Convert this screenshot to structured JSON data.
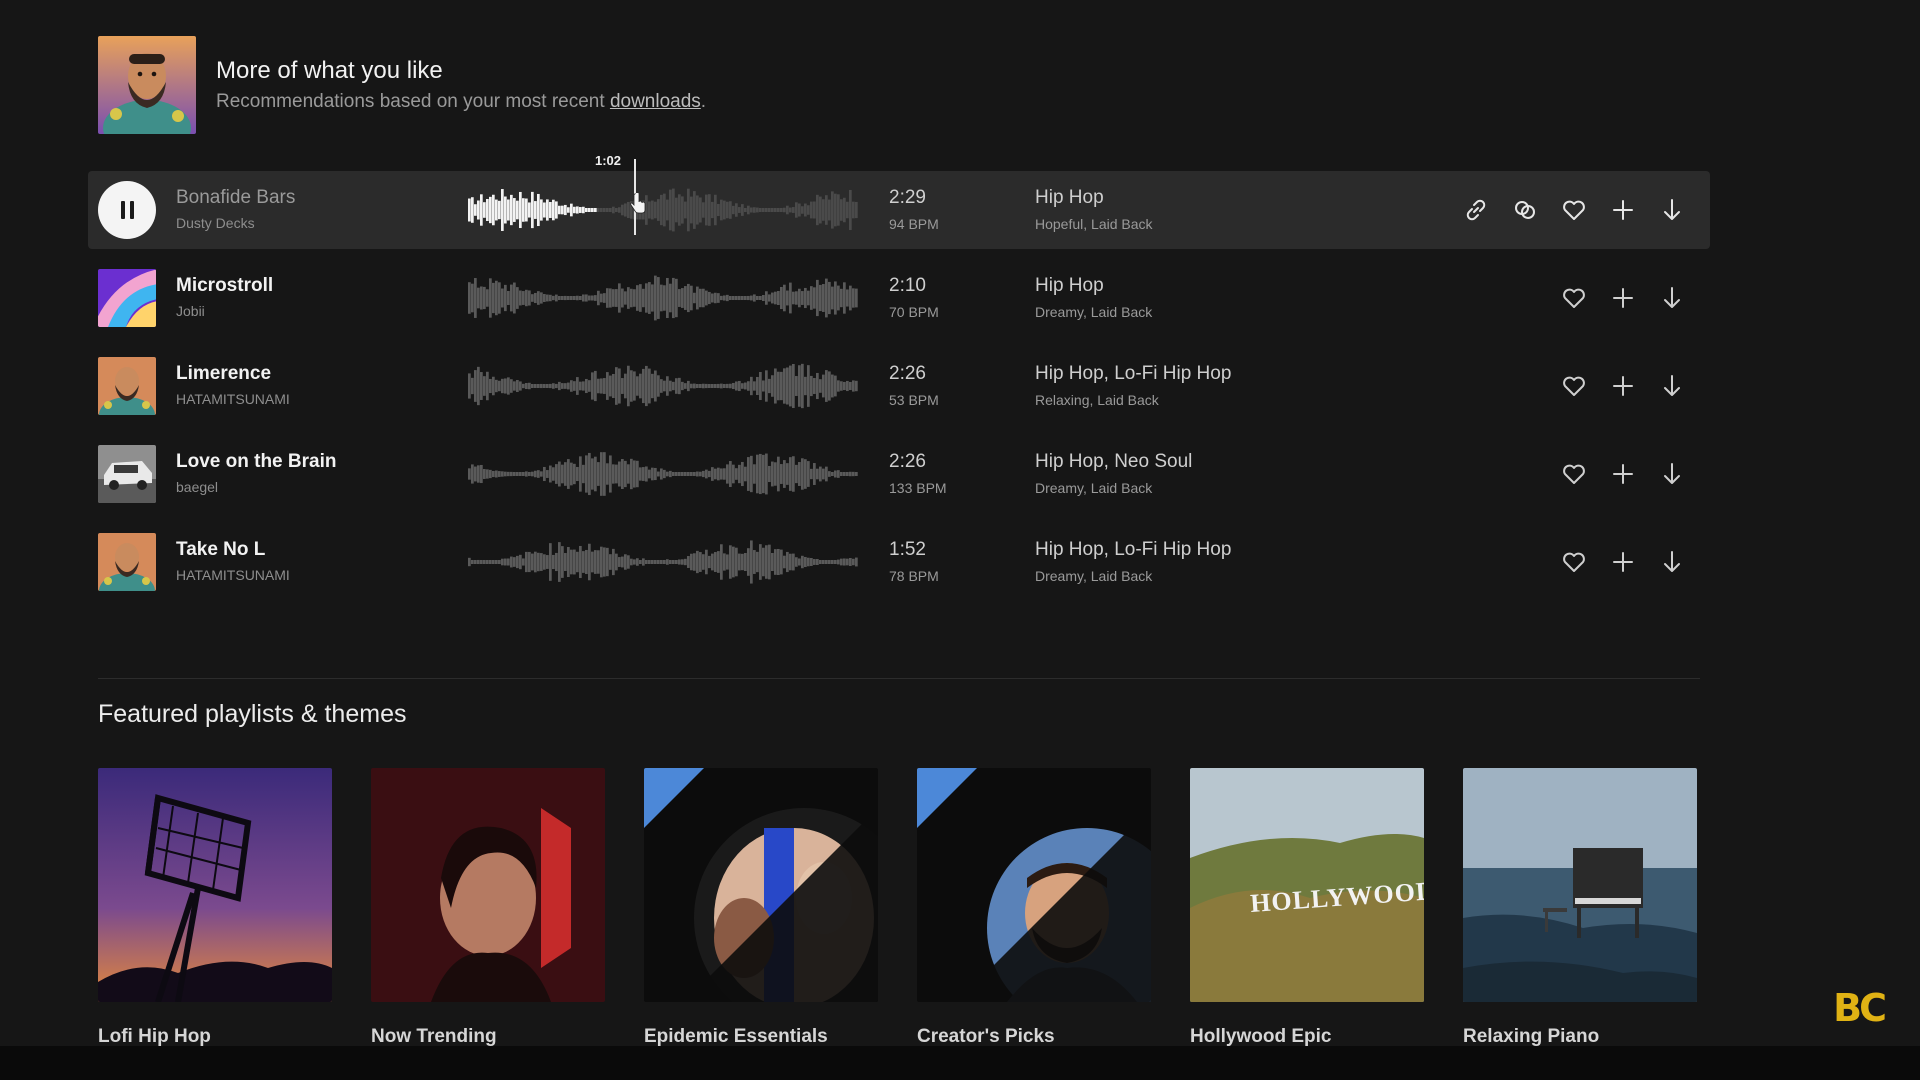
{
  "recommendations": {
    "title": "More of what you like",
    "subtitle_prefix": "Recommendations based on your most recent ",
    "subtitle_link": "downloads",
    "subtitle_suffix": "."
  },
  "player": {
    "current_time": "1:02",
    "progress": 0.42
  },
  "tracks": [
    {
      "title": "Bonafide Bars",
      "artist": "Dusty Decks",
      "duration": "2:29",
      "bpm": "94 BPM",
      "genre": "Hip Hop",
      "moods": "Hopeful, Laid Back",
      "playing": true
    },
    {
      "title": "Microstroll",
      "artist": "Jobii",
      "duration": "2:10",
      "bpm": "70 BPM",
      "genre": "Hip Hop",
      "moods": "Dreamy, Laid Back"
    },
    {
      "title": "Limerence",
      "artist": "HATAMITSUNAMI",
      "duration": "2:26",
      "bpm": "53 BPM",
      "genre": "Hip Hop, Lo-Fi Hip Hop",
      "moods": "Relaxing, Laid Back"
    },
    {
      "title": "Love on the Brain",
      "artist": "baegel",
      "duration": "2:26",
      "bpm": "133 BPM",
      "genre": "Hip Hop, Neo Soul",
      "moods": "Dreamy, Laid Back"
    },
    {
      "title": "Take No L",
      "artist": "HATAMITSUNAMI",
      "duration": "1:52",
      "bpm": "78 BPM",
      "genre": "Hip Hop, Lo-Fi Hip Hop",
      "moods": "Dreamy, Laid Back"
    }
  ],
  "featured": {
    "title": "Featured playlists & themes",
    "playlists": [
      {
        "name": "Lofi Hip Hop"
      },
      {
        "name": "Now Trending"
      },
      {
        "name": "Epidemic Essentials"
      },
      {
        "name": "Creator's Picks"
      },
      {
        "name": "Hollywood Epic",
        "sign_text": "HOLLYWOOD"
      },
      {
        "name": "Relaxing Piano"
      }
    ]
  },
  "brand": {
    "logo_text": "BC",
    "accent": "#e0b214"
  }
}
